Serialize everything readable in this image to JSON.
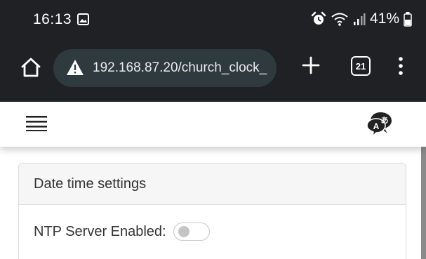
{
  "status_bar": {
    "time": "16:13",
    "battery": "41%",
    "icons": [
      "gallery-icon",
      "alarm-icon",
      "wifi-icon",
      "signal-icon",
      "battery-icon"
    ]
  },
  "browser": {
    "url": "192.168.87.20/church_clock_",
    "tab_count": "21",
    "icons": [
      "home-icon",
      "warning-icon",
      "plus-icon",
      "more-vert-icon"
    ]
  },
  "app_bar": {
    "icons": [
      "hamburger-icon",
      "language-icon"
    ],
    "lang_letter_a": "A",
    "lang_letter_b": "あ"
  },
  "card": {
    "title": "Date time settings",
    "ntp_label": "NTP Server Enabled:",
    "ntp_enabled": false
  },
  "colors": {
    "chrome_bg": "#202124",
    "omnibox_bg": "#2f3a3f",
    "card_header_bg": "#f6f6f6"
  }
}
